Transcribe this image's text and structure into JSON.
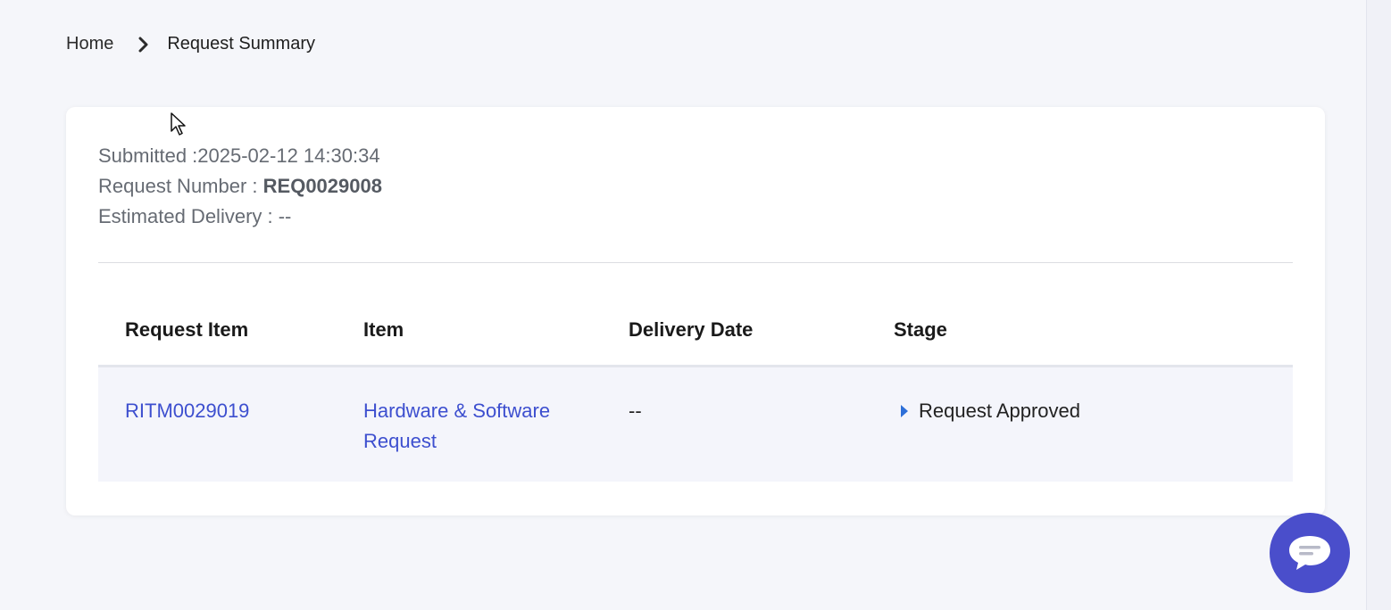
{
  "breadcrumb": {
    "home": "Home",
    "current": "Request Summary"
  },
  "summary": {
    "submitted_label": "Submitted :",
    "submitted_value": "2025-02-12 14:30:34",
    "request_number_label": "Request Number : ",
    "request_number_value": "REQ0029008",
    "estimated_delivery_label": "Estimated Delivery : ",
    "estimated_delivery_value": "--"
  },
  "table": {
    "headers": [
      "Request Item",
      "Item",
      "Delivery Date",
      "Stage"
    ],
    "rows": [
      {
        "request_item": "RITM0029019",
        "item": "Hardware & Software Request",
        "delivery_date": "--",
        "stage": "Request Approved"
      }
    ]
  },
  "icons": {
    "breadcrumb_separator": "chevron-right-icon",
    "stage": "caret-right-icon",
    "chat": "chat-bubble-icon"
  },
  "colors": {
    "link": "#3d4fcf",
    "chat_button": "#4a4ecb",
    "stage_icon": "#2d6fd8"
  }
}
